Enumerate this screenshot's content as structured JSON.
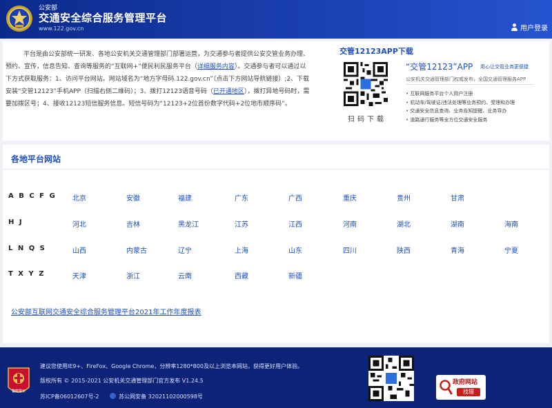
{
  "header": {
    "subtitle": "公安部",
    "title": "交通安全综合服务管理平台",
    "url": "www.122.gov.cn",
    "login_label": "用户登录"
  },
  "intro": {
    "part1": "平台是由公安部统一研发、各地公安机关交通管理部门部署运营，为交通参与者提供公安交管业务办理、预约、宣传，信息告知、查询等服务的“互联网+”便民利民服务平台（",
    "link1": "详细服务内容",
    "part2": "）。交通参与者可以通过以下方式获取服务：1、访问平台网站。网站域名为“地方字母码.122.gov.cn”（点击下方网站导航链接）;2、下载安装“交管12123”手机APP（扫描右侧二维码）；3、拨打12123语音号码（",
    "link2": "已开通地区",
    "part3": "），拨打异地号码时，需要加拨区号；4、接收12123短信服务信息。短信号码为“12123+2位首份数字代码+2位地市顺序码”。"
  },
  "app": {
    "heading": "交管12123APP下载",
    "scan_label": "扫码下载",
    "name": "“交管12123”APP",
    "tagline": "用心让交管业务更便捷",
    "desc": "公安机关交通管理部门权威发布，全国交通管理服务APP",
    "features": [
      "互联网服务平台个人用户注册",
      "机动车/驾驶证/违法处理等业务预约、受理和办理",
      "交通安全信息查询、业务告知提醒、业务导办",
      "道路通行服务等全方位交通安全服务"
    ]
  },
  "regions": {
    "heading": "各地平台网站",
    "rows": [
      {
        "letters": "A B C F G",
        "provinces": [
          "北京",
          "安徽",
          "福建",
          "广东",
          "广西",
          "重庆",
          "贵州",
          "甘肃"
        ]
      },
      {
        "letters": "H J",
        "provinces": [
          "河北",
          "吉林",
          "黑龙江",
          "江苏",
          "江西",
          "河南",
          "湖北",
          "湖南",
          "海南"
        ]
      },
      {
        "letters": "L N Q S",
        "provinces": [
          "山西",
          "内蒙古",
          "辽宁",
          "上海",
          "山东",
          "四川",
          "陕西",
          "青海",
          "宁夏"
        ]
      },
      {
        "letters": "T X Y Z",
        "provinces": [
          "天津",
          "浙江",
          "云南",
          "西藏",
          "新疆"
        ]
      }
    ],
    "report_link": "公安部互联网交通安全综合服务管理平台2021年工作年度报表"
  },
  "footer": {
    "badge_text": "警徽警示",
    "browser_note": "建议您使用IE9+、FireFox、Google Chrome，分辨率1280*800及以上浏览本网站，获得更好用户体验。",
    "copyright": "版权所有 © 2015-2021 公安机关交通管理部门官方发布 V1.24.5",
    "icp": "苏ICP备06012607号-2",
    "police_record": "苏公网安备 32021102000598号",
    "gov_title": "政府网站",
    "gov_button": "找错"
  },
  "colors": {
    "header_bg": "#1a3fb0",
    "footer_bg": "#0c2378",
    "link": "#1d4fbf",
    "page_bg": "#eef1f7"
  }
}
